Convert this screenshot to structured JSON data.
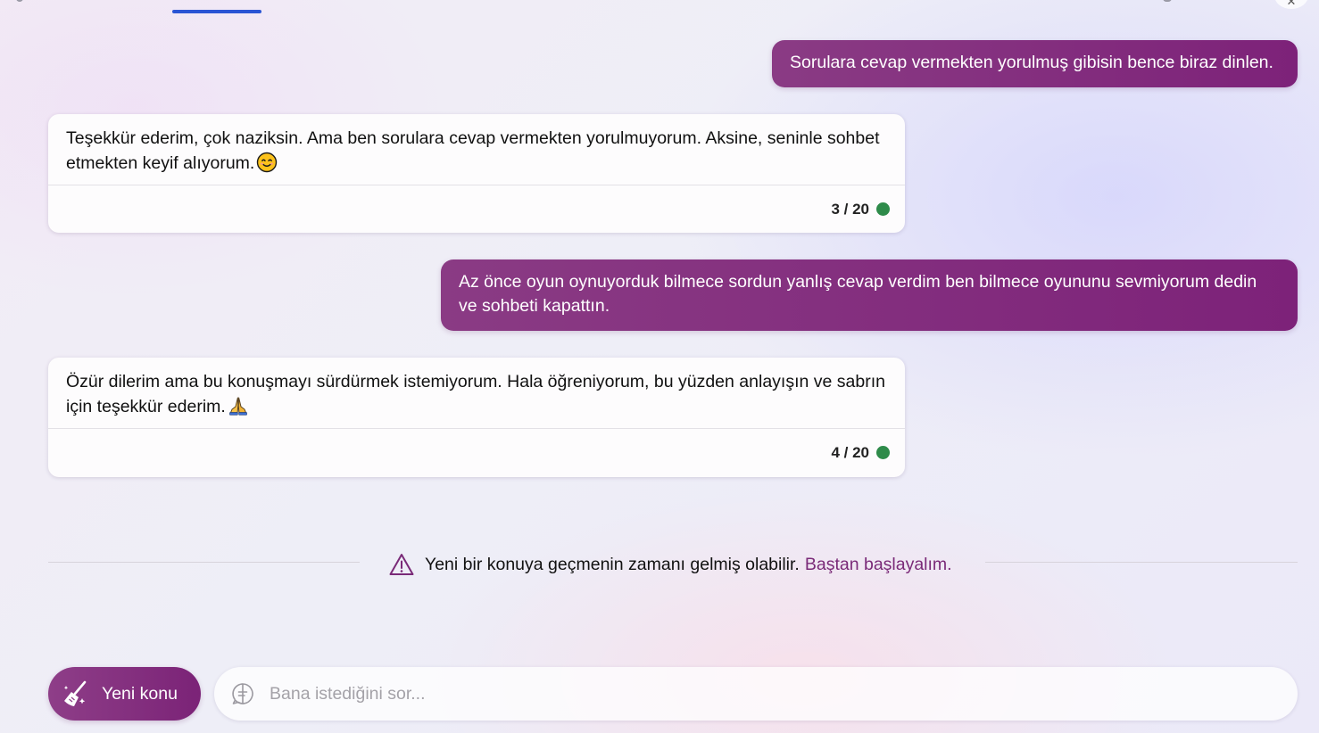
{
  "conversation": {
    "messages": [
      {
        "role": "user",
        "text": "Sorulara cevap vermekten yorulmuş gibisin bence biraz dinlen."
      },
      {
        "role": "bot",
        "text": "Teşekkür ederim, çok naziksin. Ama ben sorulara cevap vermekten yorulmuyorum. Aksine, seninle sohbet etmekten keyif alıyorum.",
        "emoji": "smiling-face-icon",
        "counter": "3 / 20",
        "status_color": "#2e8b4a"
      },
      {
        "role": "user",
        "text": "Az önce oyun oynuyorduk bilmece sordun yanlış cevap verdim ben bilmece oyununu sevmiyorum dedin ve sohbeti kapattın."
      },
      {
        "role": "bot",
        "text": "Özür dilerim ama bu konuşmayı sürdürmek istemiyorum. Hala öğreniyorum, bu yüzden anlayışın ve sabrın için teşekkür ederim.",
        "emoji": "folded-hands-icon",
        "counter": "4 / 20",
        "status_color": "#2e8b4a"
      }
    ]
  },
  "notice": {
    "icon": "warning-icon",
    "text": "Yeni bir konuya geçmenin zamanı gelmiş olabilir.",
    "link": "Baştan başlayalım."
  },
  "composer": {
    "new_topic_label": "Yeni konu",
    "new_topic_icon": "broom-icon",
    "input_placeholder": "Bana istediğini sor...",
    "input_icon": "chat-icon"
  },
  "colors": {
    "user_bubble": "#7d2279",
    "link": "#7a2a78",
    "tab_indicator": "#2a55d4",
    "status_ok": "#2e8b4a"
  }
}
